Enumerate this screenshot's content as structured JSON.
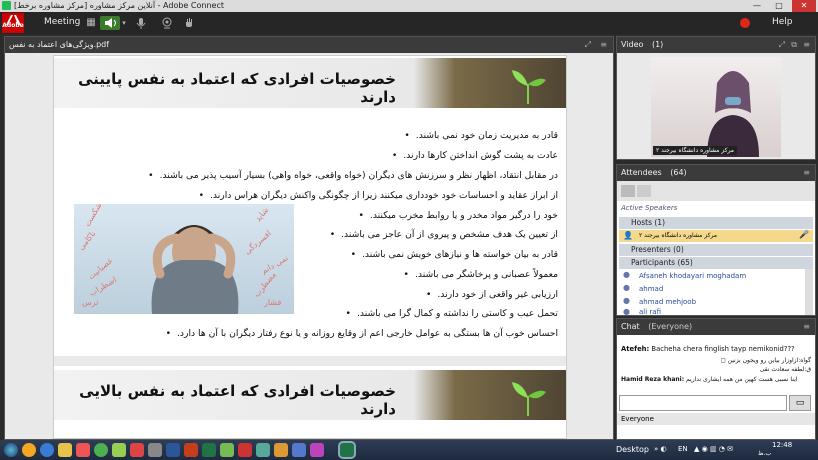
{
  "window": {
    "title": "آنلاین مرکز مشاوره [مرکز مشاوره برخط] - Adobe Connect",
    "close": "✕",
    "maximize": "□",
    "minimize": "—"
  },
  "toolbar": {
    "adobe_logo": "Adobe",
    "meeting_menu": "Meeting",
    "help_menu": "Help"
  },
  "share_pod": {
    "filename": "ویژگی‌های اعتماد به نفس.pdf",
    "slide1_title": "خصوصیات افرادی که اعتماد به نفس پایینی دارند",
    "bullets": [
      "قادر به مدیریت زمان خود نمی باشند.",
      "عادت به پشت گوش انداختن کارها دارند.",
      "در مقابل انتقاد، اظهار نظر و سرزنش های دیگران (خواه واقعی، خواه واهی) بسیار آسیب پذیر می باشند.",
      "از ابراز عقاید و احساسات خود خودداری میکنند زیرا از چگونگی واکنش دیگران هراس دارند.",
      "خود را درگیر مواد مخدر و یا روابط مخرب میکنند.",
      "از تعیین یک هدف مشخص و پیروی از آن عاجز می باشند.",
      "قادر به بیان خواسته ها و نیازهای خویش نمی باشند.",
      "معمولاً عصبانی و پرخاشگر می باشند.",
      "ارزیابی غیر واقعی از خود دارند.",
      "تحمل عیب و کاستی را نداشته و کمال گرا می باشند.",
      "احساس خوب آن ها بستگی به عوامل خارجی اعم از وقایع روزانه و یا نوع رفتار دیگران با آن ها دارد."
    ],
    "image_words": [
      "شکست",
      "ناکامی",
      "عصبانیت",
      "اضطراب",
      "ترس",
      "شاید",
      "افسردگی",
      "نمی دانم",
      "مضطرب",
      "فشار"
    ],
    "slide2_title": "خصوصیات افرادی که اعتماد به نفس بالایی دارند"
  },
  "video_pod": {
    "title": "Video",
    "count": "(1)",
    "caption": "مرکز مشاوره دانشگاه بیرجند ۲"
  },
  "attendees_pod": {
    "title": "Attendees",
    "count": "(64)",
    "active_speakers": "Active Speakers",
    "hosts_label": "Hosts (1)",
    "host_name": "مرکز مشاوره دانشگاه بیرجند ۲",
    "presenters_label": "Presenters (0)",
    "participants_label": "Participants (65)",
    "participants": [
      "Afsaneh khodayari moghadam",
      "ahmad",
      "ahmad mehjoob",
      "ali rafi"
    ]
  },
  "chat_pod": {
    "title": "Chat",
    "scope": "(Everyone)",
    "messages": [
      {
        "sender": "Atefeh:",
        "text": "Bacheha chera finglish tayp nemikonid???"
      },
      {
        "sender": "",
        "text": "گواه:ازاوزار بیاین رو ویجون بزنین ◻"
      },
      {
        "sender": "",
        "text": "ق:لطفه سعادت نقی"
      },
      {
        "sender": "Hamid Reza khani:",
        "text": "اینا نسبی هست کهین من همه ایشاری نداریم"
      }
    ],
    "recipient": "Everyone"
  },
  "taskbar": {
    "desktop_label": "Desktop",
    "lang": "EN",
    "time": "12:48",
    "ampm": "ب.ظ"
  },
  "colors": {
    "accent_green": "#3a7a2a",
    "record_red": "#e0261c",
    "dark_chrome": "#262626"
  }
}
